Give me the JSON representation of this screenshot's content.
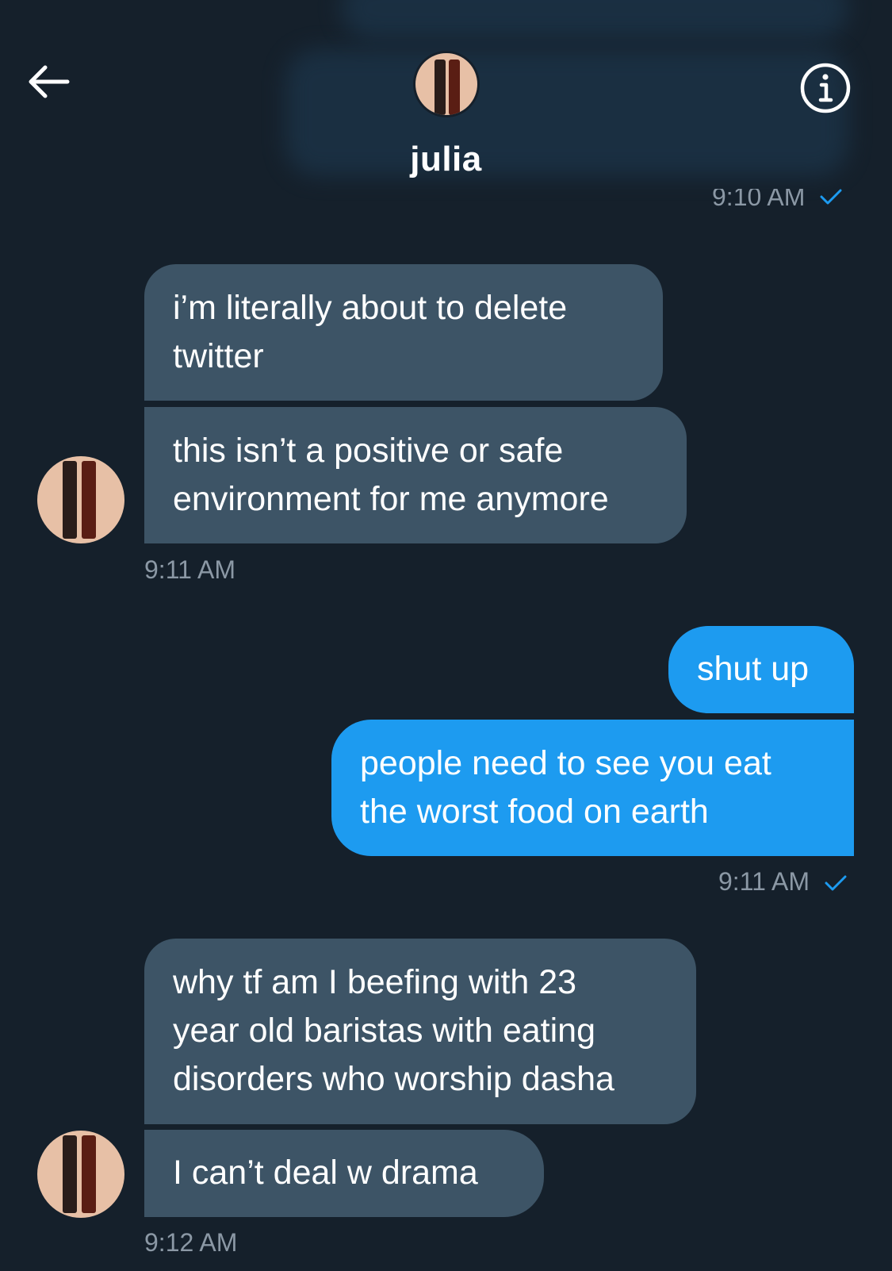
{
  "header": {
    "back_icon": "arrow-left-icon",
    "info_icon": "info-circle-icon",
    "name": "julia"
  },
  "messages": [
    {
      "id": "m0",
      "direction": "outgoing",
      "timestamp": "9:10 AM",
      "read": true
    },
    {
      "id": "m1",
      "direction": "incoming",
      "lines": [
        "i’m literally about to delete",
        "twitter"
      ]
    },
    {
      "id": "m2",
      "direction": "incoming",
      "lines": [
        "this isn’t a positive or safe",
        "environment for me anymore"
      ],
      "timestamp": "9:11 AM"
    },
    {
      "id": "m3",
      "direction": "outgoing",
      "lines": [
        "shut up"
      ]
    },
    {
      "id": "m4",
      "direction": "outgoing",
      "lines": [
        "people need to see you eat",
        "the worst food on earth"
      ],
      "timestamp": "9:11 AM",
      "read": true
    },
    {
      "id": "m5",
      "direction": "incoming",
      "lines": [
        "why tf am I beefing with 23",
        "year old baristas with eating",
        "disorders who worship dasha"
      ]
    },
    {
      "id": "m6",
      "direction": "incoming",
      "lines": [
        "I can’t deal w drama"
      ],
      "timestamp": "9:12 AM"
    }
  ],
  "colors": {
    "background": "#15202b",
    "incoming_bubble": "#3d5466",
    "outgoing_bubble": "#1d9bf0",
    "timestamp": "#8b98a5",
    "read_check": "#1d9bf0"
  }
}
